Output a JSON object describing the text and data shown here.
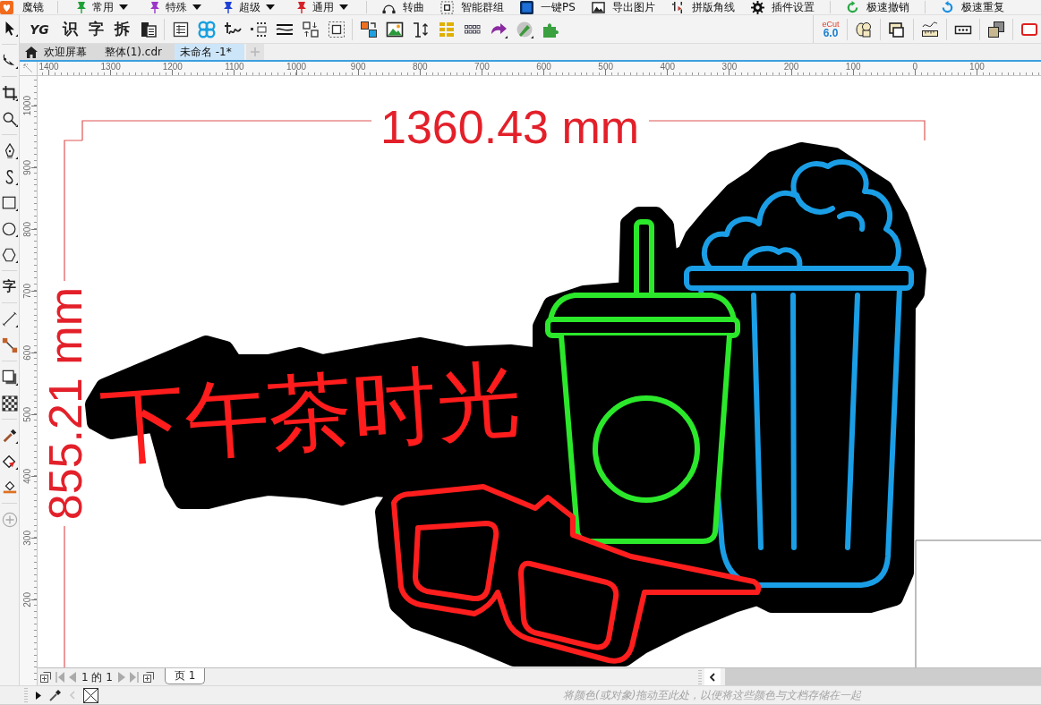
{
  "menu_bar": {
    "logo": "魔镜",
    "dropdowns": [
      {
        "label": "常用",
        "color": "#22a038"
      },
      {
        "label": "特殊",
        "color": "#9b35c8"
      },
      {
        "label": "超级",
        "color": "#1d3fd8"
      },
      {
        "label": "通用",
        "color": "#d42228"
      }
    ],
    "commands": [
      "转曲",
      "智能群组",
      "一键PS",
      "导出图片",
      "拼版角线",
      "插件设置",
      "极速撤销",
      "极速重复"
    ]
  },
  "toolbar": {
    "text_tools": [
      "YG",
      "识",
      "字",
      "拆"
    ],
    "plugin_badge": {
      "brand": "eCut",
      "version": "6.0"
    }
  },
  "document_tabs": [
    {
      "label": "欢迎屏幕",
      "kind": "home",
      "selected": false
    },
    {
      "label": "整体(1).cdr",
      "kind": "document",
      "selected": false
    },
    {
      "label": "未命名 -1*",
      "kind": "document",
      "selected": true
    }
  ],
  "toolbox": {
    "text_tool": "字"
  },
  "rulers": {
    "horizontal": [
      "1400",
      "1300",
      "1200",
      "1100",
      "1000",
      "900",
      "800",
      "700",
      "600",
      "500",
      "400",
      "300",
      "200",
      "100",
      "0",
      "100"
    ],
    "vertical": [
      "1000",
      "900",
      "800",
      "700",
      "600",
      "500",
      "400",
      "300",
      "200"
    ]
  },
  "canvas": {
    "width_dimension": "1360.43 mm",
    "height_dimension": "855.21 mm",
    "sign_text": "下午茶时光"
  },
  "page_navigator": {
    "page_count": "1 的 1",
    "page_tab": "页 1"
  },
  "color_palette": {
    "hint": "将颜色(或对象)拖动至此处，以便将这些颜色与文档存储在一起"
  }
}
